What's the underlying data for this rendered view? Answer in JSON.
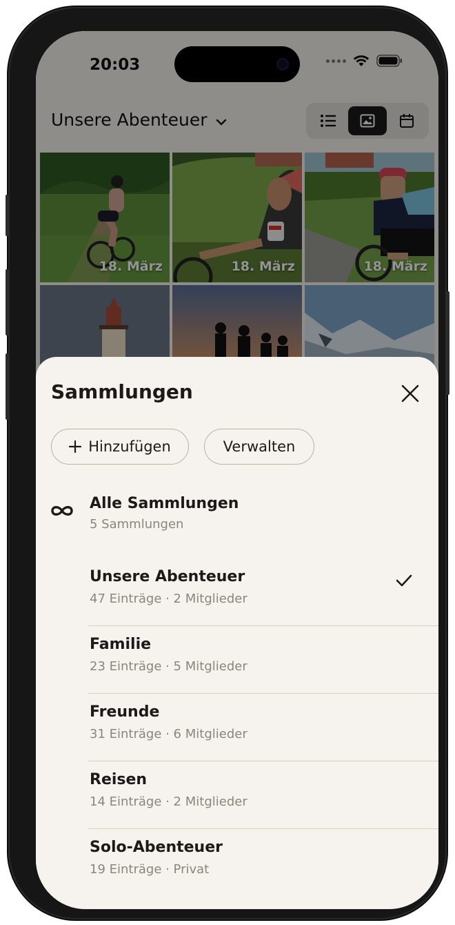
{
  "status_bar": {
    "time": "20:03"
  },
  "header": {
    "collection_title": "Unsere Abenteuer",
    "view_modes": [
      "list",
      "grid",
      "calendar"
    ],
    "active_view": "grid"
  },
  "photos": [
    {
      "date": "18. März"
    },
    {
      "date": "18. März"
    },
    {
      "date": "18. März"
    },
    {
      "date": ""
    },
    {
      "date": ""
    },
    {
      "date": ""
    }
  ],
  "sheet": {
    "title": "Sammlungen",
    "add_label": "Hinzufügen",
    "manage_label": "Verwalten",
    "all": {
      "name": "Alle Sammlungen",
      "sub": "5 Sammlungen"
    },
    "collections": [
      {
        "name": "Unsere Abenteuer",
        "sub": "47 Einträge · 2 Mitglieder",
        "selected": true
      },
      {
        "name": "Familie",
        "sub": "23 Einträge · 5 Mitglieder",
        "selected": false
      },
      {
        "name": "Freunde",
        "sub": "31 Einträge · 6 Mitglieder",
        "selected": false
      },
      {
        "name": "Reisen",
        "sub": "14 Einträge · 2 Mitglieder",
        "selected": false
      },
      {
        "name": "Solo-Abenteuer",
        "sub": "19 Einträge · Privat",
        "selected": false
      }
    ]
  },
  "colors": {
    "sheet_bg": "#f6f3ee",
    "divider": "#d8cfba",
    "text_primary": "#1c1a17",
    "text_secondary": "#8a857d"
  }
}
